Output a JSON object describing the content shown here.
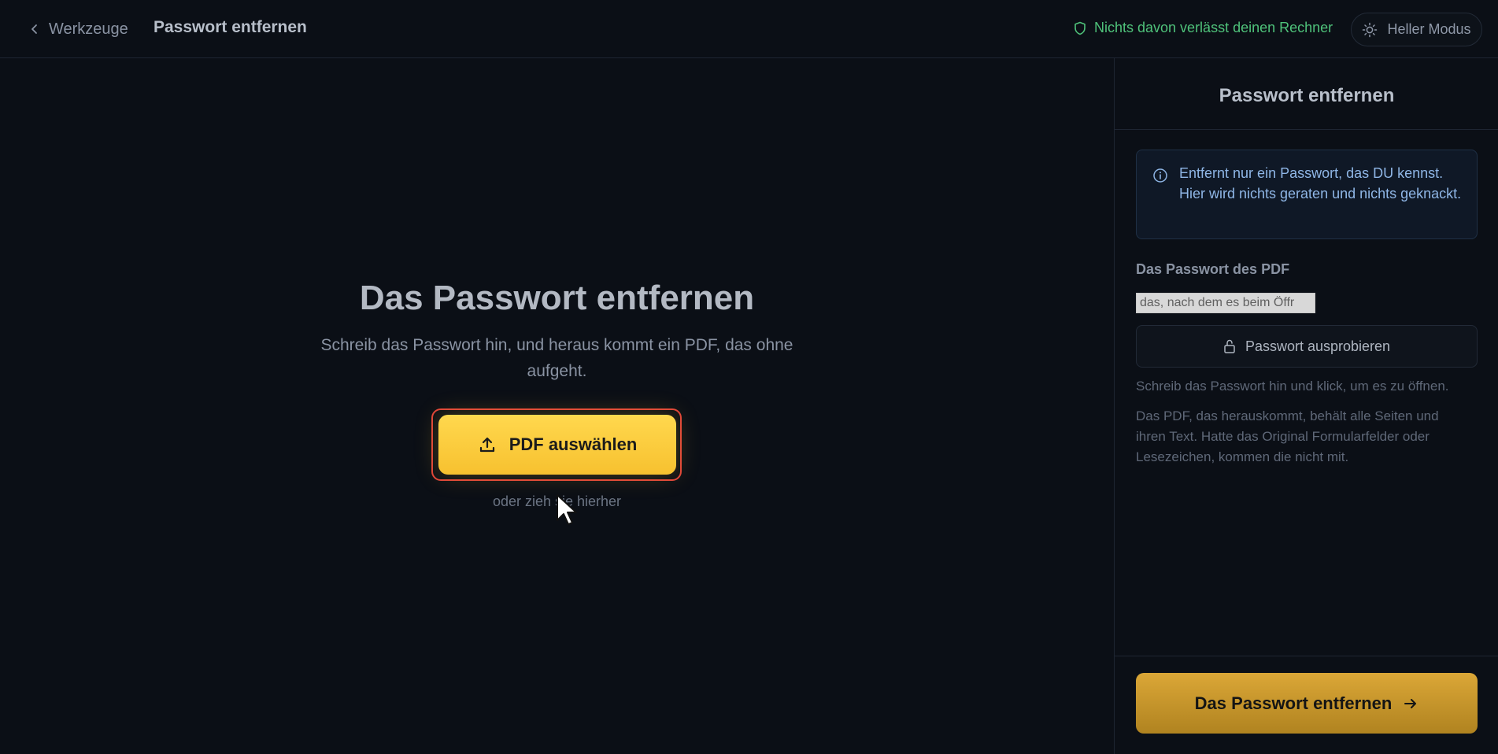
{
  "header": {
    "back_label": "Werkzeuge",
    "title": "Passwort entfernen",
    "privacy_text": "Nichts davon verlässt deinen Rechner",
    "theme_label": "Heller Modus"
  },
  "main": {
    "heading": "Das Passwort entfernen",
    "subtitle": "Schreib das Passwort hin, und heraus kommt ein PDF, das ohne aufgeht.",
    "upload_label": "PDF auswählen",
    "drop_hint": "oder zieh sie hierher"
  },
  "sidebar": {
    "title": "Passwort entfernen",
    "info": "Entfernt nur ein Passwort, das DU kennst. Hier wird nichts geraten und nichts geknackt.",
    "password_label": "Das Passwort des PDF",
    "password_placeholder": "das, nach dem es beim Öffr",
    "try_label": "Passwort ausprobieren",
    "hint_1": "Schreib das Passwort hin und klick, um es zu öffnen.",
    "hint_2": "Das PDF, das herauskommt, behält alle Seiten und ihren Text. Hatte das Original Formularfelder oder Lesezeichen, kommen die nicht mit.",
    "submit_label": "Das Passwort entfernen"
  },
  "colors": {
    "accent": "#f7c12f",
    "privacy_green": "#4fc27a",
    "info_blue": "#8fb6e6",
    "highlight_border": "#e0443a"
  }
}
